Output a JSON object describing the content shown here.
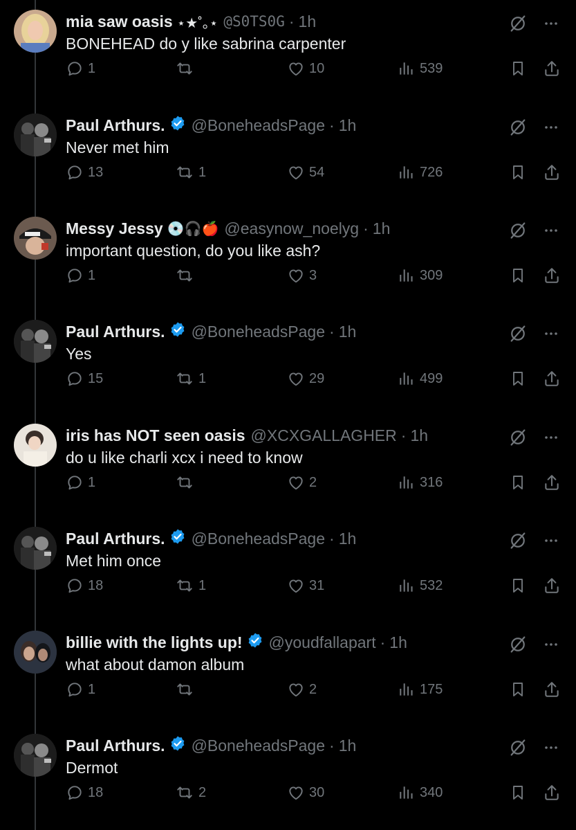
{
  "tweets": [
    {
      "name": "mia saw oasis",
      "name_suffix": "⋆★˚｡⋆",
      "handle": "@S0TS0G",
      "time": "1h",
      "verified": false,
      "emojis": "",
      "text": "BONEHEAD do y like sabrina carpenter",
      "replies": "1",
      "reposts": "",
      "likes": "10",
      "views": "539",
      "avatar_icon": "avatar-blonde-woman"
    },
    {
      "name": "Paul Arthurs.",
      "name_suffix": "",
      "handle": "@BoneheadsPage",
      "time": "1h",
      "verified": true,
      "emojis": "",
      "text": "Never met him",
      "replies": "13",
      "reposts": "1",
      "likes": "54",
      "views": "726",
      "avatar_icon": "avatar-bw-photo"
    },
    {
      "name": "Messy Jessy",
      "name_suffix": "",
      "handle": "@easynow_noelyg",
      "time": "1h",
      "verified": false,
      "emojis": "💿🎧🍎",
      "text": "important question, do you like ash?",
      "replies": "1",
      "reposts": "",
      "likes": "3",
      "views": "309",
      "avatar_icon": "avatar-cap-photo"
    },
    {
      "name": "Paul Arthurs.",
      "name_suffix": "",
      "handle": "@BoneheadsPage",
      "time": "1h",
      "verified": true,
      "emojis": "",
      "text": "Yes",
      "replies": "15",
      "reposts": "1",
      "likes": "29",
      "views": "499",
      "avatar_icon": "avatar-bw-photo"
    },
    {
      "name": "iris has NOT seen oasis",
      "name_suffix": "",
      "handle": "@XCXGALLAGHER",
      "time": "1h",
      "verified": false,
      "emojis": "",
      "text": "do u like charli xcx i need to know",
      "replies": "1",
      "reposts": "",
      "likes": "2",
      "views": "316",
      "avatar_icon": "avatar-light-photo"
    },
    {
      "name": "Paul Arthurs.",
      "name_suffix": "",
      "handle": "@BoneheadsPage",
      "time": "1h",
      "verified": true,
      "emojis": "",
      "text": "Met him once",
      "replies": "18",
      "reposts": "1",
      "likes": "31",
      "views": "532",
      "avatar_icon": "avatar-bw-photo"
    },
    {
      "name": "billie with the lights up!",
      "name_suffix": "",
      "handle": "@youdfallapart",
      "time": "1h",
      "verified": true,
      "emojis": "",
      "text": "what about damon album",
      "replies": "1",
      "reposts": "",
      "likes": "2",
      "views": "175",
      "avatar_icon": "avatar-dark-photo"
    },
    {
      "name": "Paul Arthurs.",
      "name_suffix": "",
      "handle": "@BoneheadsPage",
      "time": "1h",
      "verified": true,
      "emojis": "",
      "text": "Dermot",
      "replies": "18",
      "reposts": "2",
      "likes": "30",
      "views": "340",
      "avatar_icon": "avatar-bw-photo"
    }
  ],
  "separator": "·",
  "colors": {
    "background": "#000000",
    "text": "#e7e9ea",
    "muted": "#71767b",
    "verified": "#1d9bf0",
    "thread_line": "#333639"
  },
  "icons": [
    "grok-icon",
    "more-icon",
    "reply-icon",
    "repost-icon",
    "like-icon",
    "views-icon",
    "bookmark-icon",
    "share-icon",
    "verified-badge-icon"
  ]
}
